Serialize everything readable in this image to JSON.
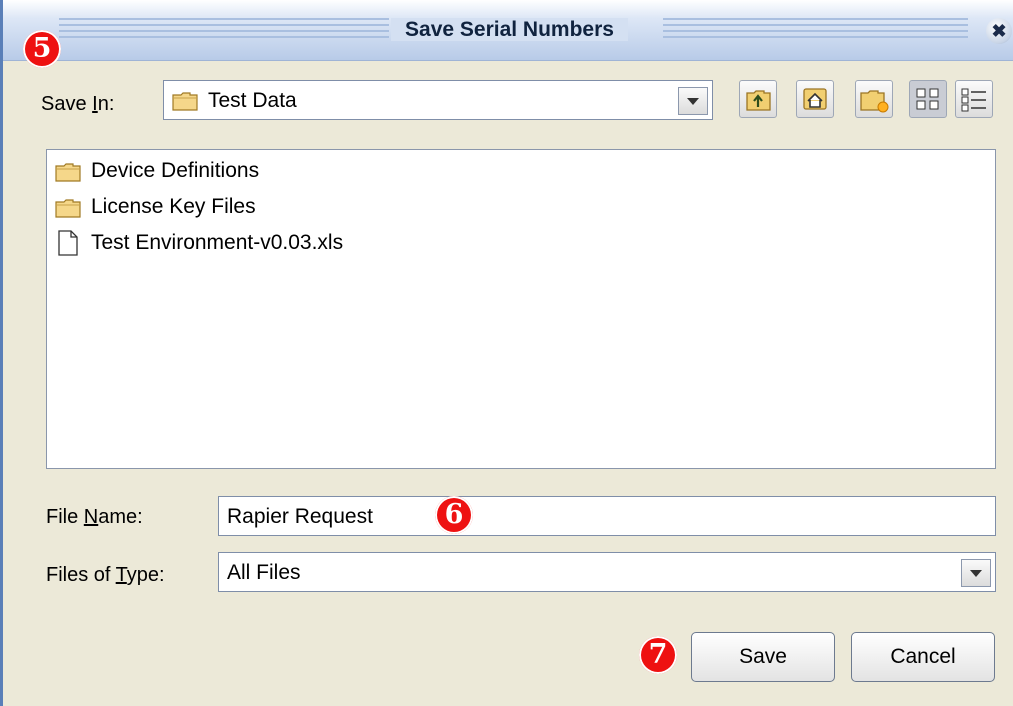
{
  "window": {
    "title": "Save Serial Numbers",
    "close_glyph": "✖"
  },
  "callouts": {
    "five": "5",
    "six": "6",
    "seven": "7"
  },
  "save_in": {
    "label_pre": "Save ",
    "label_key": "I",
    "label_post": "n:",
    "value": "Test Data"
  },
  "toolbar": {
    "icons": [
      "up-folder-icon",
      "home-icon",
      "new-folder-icon",
      "list-view-icon",
      "details-view-icon"
    ]
  },
  "files": [
    {
      "name": "Device Definitions",
      "type": "folder"
    },
    {
      "name": "License Key Files",
      "type": "folder"
    },
    {
      "name": "Test Environment-v0.03.xls",
      "type": "file"
    }
  ],
  "file_name": {
    "label_pre": "File ",
    "label_key": "N",
    "label_post": "ame:",
    "value": "Rapier Request"
  },
  "file_type": {
    "label_pre": "Files of ",
    "label_key": "T",
    "label_post": "ype:",
    "value": "All Files"
  },
  "buttons": {
    "save": "Save",
    "cancel": "Cancel"
  },
  "colors": {
    "callout": "#e11111",
    "titlebar": "#b8cbe8"
  }
}
